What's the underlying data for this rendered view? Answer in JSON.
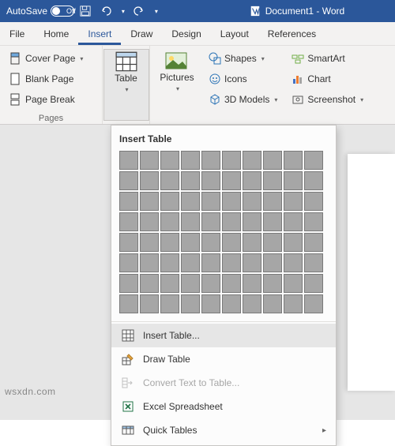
{
  "titlebar": {
    "autosave_label": "AutoSave",
    "autosave_state": "Off",
    "doc_title": "Document1 - Word"
  },
  "tabs": {
    "file": "File",
    "home": "Home",
    "insert": "Insert",
    "draw": "Draw",
    "design": "Design",
    "layout": "Layout",
    "references": "References"
  },
  "ribbon": {
    "pages": {
      "cover_page": "Cover Page",
      "blank_page": "Blank Page",
      "page_break": "Page Break",
      "group_label": "Pages"
    },
    "tables": {
      "table": "Table"
    },
    "illustrations": {
      "pictures": "Pictures",
      "shapes": "Shapes",
      "icons": "Icons",
      "models": "3D Models",
      "smartart": "SmartArt",
      "chart": "Chart",
      "screenshot": "Screenshot"
    }
  },
  "dropdown": {
    "title": "Insert Table",
    "grid": {
      "cols": 10,
      "rows": 8
    },
    "insert_table": "Insert Table...",
    "draw_table": "Draw Table",
    "convert": "Convert Text to Table...",
    "excel": "Excel Spreadsheet",
    "quick": "Quick Tables"
  },
  "watermark": "wsxdn.com"
}
